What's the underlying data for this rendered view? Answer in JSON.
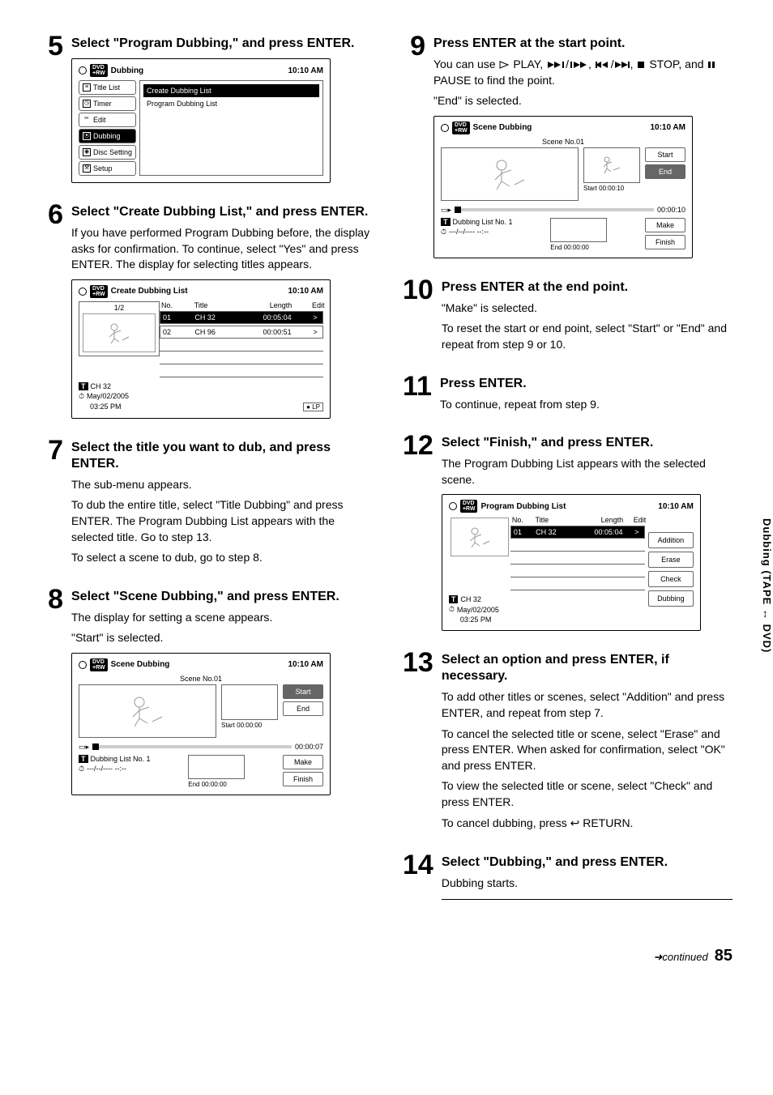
{
  "side_tab": "Dubbing (TAPE ↔ DVD)",
  "footer": {
    "continued": "➜continued",
    "page": "85"
  },
  "steps": {
    "5": {
      "title": "Select \"Program Dubbing,\" and press ENTER.",
      "panel": {
        "header_title": "Dubbing",
        "header_time": "10:10 AM",
        "tabs": [
          "Title List",
          "Timer",
          "Edit",
          "Dubbing",
          "Disc Setting",
          "Setup"
        ],
        "selected_tab_index": 3,
        "content_items": [
          "Create Dubbing List",
          "Program Dubbing List"
        ],
        "selected_content_index": 0
      }
    },
    "6": {
      "title": "Select \"Create Dubbing List,\" and press ENTER.",
      "text": "If you have performed Program Dubbing before, the display asks for confirmation. To continue, select \"Yes\" and press ENTER. The display for selecting titles appears.",
      "panel": {
        "header_title": "Create Dubbing List",
        "header_time": "10:10 AM",
        "page_indicator": "1/2",
        "thead": {
          "no": "No.",
          "title": "Title",
          "length": "Length",
          "edit": "Edit"
        },
        "rows": [
          {
            "no": "01",
            "title": "CH 32",
            "length": "00:05:04",
            "edit": ">",
            "sel": true
          },
          {
            "no": "02",
            "title": "CH 96",
            "length": "00:00:51",
            "edit": ">",
            "sel": false
          }
        ],
        "meta_ch": "CH 32",
        "meta_date": "May/02/2005",
        "meta_time": "03:25  PM",
        "meta_mode": "LP",
        "t_badge": "T",
        "clock_badge": "⏱"
      }
    },
    "7": {
      "title": "Select the title you want to dub, and press ENTER.",
      "text1": "The sub-menu appears.",
      "text2": "To dub the entire title, select \"Title Dubbing\" and press ENTER. The Program Dubbing List appears with the selected title. Go to step 13.",
      "text3": "To select a scene to dub, go to step 8."
    },
    "8": {
      "title": "Select \"Scene Dubbing,\" and press ENTER.",
      "text1": "The display for setting a scene appears.",
      "text2": "\"Start\" is selected.",
      "panel": {
        "header_title": "Scene Dubbing",
        "header_time": "10:10 AM",
        "scene_label": "Scene No.01",
        "start_time": "Start 00:00:00",
        "end_time": "End   00:00:00",
        "buttons": [
          "Start",
          "End",
          "Make",
          "Finish"
        ],
        "selected_button_index": 0,
        "progress_time": "00:00:07",
        "bottom_list": "Dubbing List No. 1",
        "bottom_meta": "---/--/----  --:--",
        "t_badge": "T"
      }
    },
    "9": {
      "title": "Press ENTER at the start point.",
      "text_prefix": "You can use ",
      "text_play": " PLAY, ",
      "text_stop": " STOP, and ",
      "text_pause": " PAUSE to find the point.",
      "text2": "\"End\" is selected.",
      "panel": {
        "header_title": "Scene Dubbing",
        "header_time": "10:10 AM",
        "scene_label": "Scene No.01",
        "start_time": "Start 00:00:10",
        "end_time": "End   00:00:00",
        "buttons": [
          "Start",
          "End",
          "Make",
          "Finish"
        ],
        "selected_button_index": 1,
        "progress_time": "00:00:10",
        "bottom_list": "Dubbing List No. 1",
        "bottom_meta": "---/--/----  --:--",
        "t_badge": "T"
      }
    },
    "10": {
      "title": "Press ENTER at the end point.",
      "text1": "\"Make\" is selected.",
      "text2": "To reset the start or end point, select \"Start\" or \"End\" and repeat from step 9 or 10."
    },
    "11": {
      "title": "Press ENTER.",
      "text": "To continue, repeat from step 9."
    },
    "12": {
      "title": "Select \"Finish,\" and press ENTER.",
      "text": "The Program Dubbing List appears with the selected scene.",
      "panel": {
        "header_title": "Program Dubbing List",
        "header_time": "10:10 AM",
        "thead": {
          "no": "No.",
          "title": "Title",
          "length": "Length",
          "edit": "Edit"
        },
        "rows": [
          {
            "no": "01",
            "title": "CH 32",
            "length": "00:05:04",
            "edit": ">",
            "sel": true
          }
        ],
        "side_buttons": [
          "Addition",
          "Erase",
          "Check",
          "Dubbing"
        ],
        "meta_ch": "CH 32",
        "meta_date": "May/02/2005",
        "meta_time": "03:25  PM",
        "t_badge": "T",
        "clock_badge": "⏱"
      }
    },
    "13": {
      "title": "Select an option and press ENTER, if necessary.",
      "text1": "To add other titles or scenes, select \"Addition\" and press ENTER, and repeat from step 7.",
      "text2": "To cancel the selected title or scene, select \"Erase\" and press ENTER. When asked for confirmation, select \"OK\" and press ENTER.",
      "text3": "To view the selected title or scene, select \"Check\" and press ENTER.",
      "text4_a": "To cancel dubbing, press ",
      "text4_b": " RETURN."
    },
    "14": {
      "title": "Select \"Dubbing,\" and press ENTER.",
      "text": "Dubbing starts."
    }
  }
}
